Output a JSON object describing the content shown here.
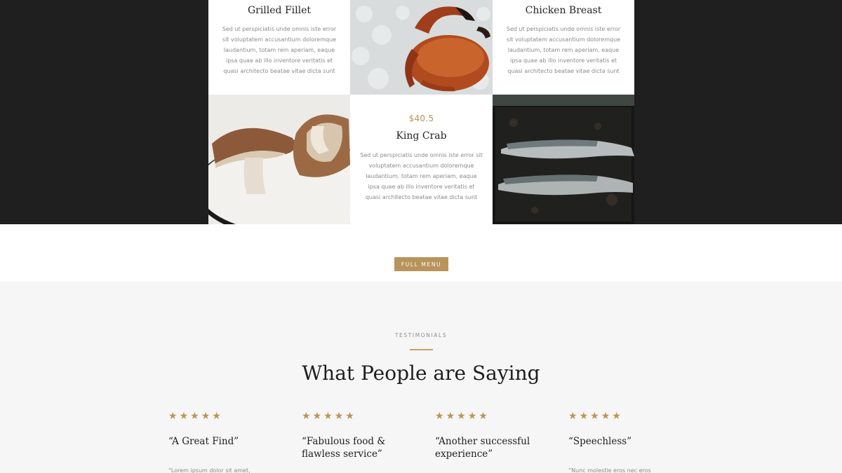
{
  "menu": {
    "items": [
      {
        "name": "Grilled Fillet",
        "description": "Sed ut perspiciatis unde omnis iste error sit voluptatem accusantium doloremque laudantium, totam rem aperiam, eaque ipsa quae ab illo inventore veritatis et quasi architecto beatae vitae dicta sunt"
      },
      {
        "name": "Chicken Breast",
        "description": "Sed ut perspiciatis unde omnis iste error sit voluptatem accusantium doloremque laudantium, totam rem aperiam, eaque ipsa quae ab illo inventore veritatis et quasi architecto beatae vitae dicta sunt"
      },
      {
        "price": "$40.5",
        "name": "King Crab",
        "description": "Sed ut perspiciatis unde omnis iste error sit voluptatem accusantium doloremque laudantium, totam rem aperiam, eaque ipsa quae ab illo inventore veritatis et quasi architecto beatae vitae dicta sunt"
      }
    ],
    "photos": [
      "crab-photo",
      "mushroom-photo",
      "fish-photo"
    ],
    "full_menu_label": "FULL MENU"
  },
  "testimonials": {
    "eyebrow": "TESTIMONIALS",
    "heading": "What People are Saying",
    "star_glyph": "★",
    "reviews": [
      {
        "rating": 5,
        "title": "“A Great Find”",
        "excerpt": "“Lorem ipsum dolor sit amet,"
      },
      {
        "rating": 5,
        "title": "“Fabulous food & flawless service”",
        "excerpt": ""
      },
      {
        "rating": 5,
        "title": "“Another successful experience”",
        "excerpt": ""
      },
      {
        "rating": 5,
        "title": "“Speechless”",
        "excerpt": "“Nunc molestie eros nec eros"
      }
    ]
  },
  "colors": {
    "accent": "#b8935a",
    "dark_band": "#1f1f1f",
    "testimonial_bg": "#f6f6f6"
  }
}
